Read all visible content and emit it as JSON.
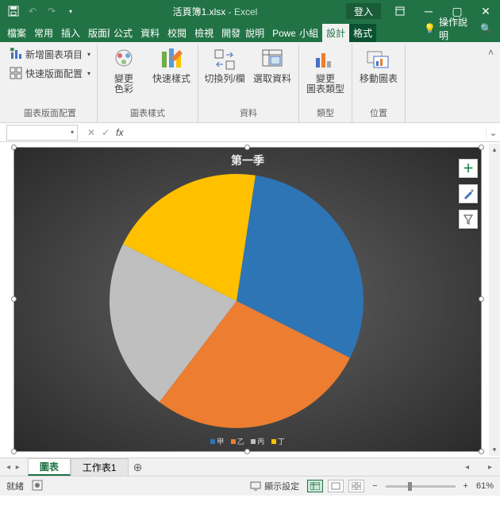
{
  "titlebar": {
    "filename": "活頁簿1.xlsx",
    "app": "Excel",
    "login": "登入"
  },
  "tabs": {
    "items": [
      "檔案",
      "常用",
      "插入",
      "版面配置",
      "公式",
      "資料",
      "校閱",
      "檢視",
      "開發人員",
      "說明",
      "Power",
      "小組",
      "設計",
      "格式"
    ],
    "active": "設計",
    "alt_tabs": [
      "設計",
      "格式"
    ],
    "help_hint": "操作說明"
  },
  "ribbon": {
    "layout": {
      "add_element": "新增圖表項目",
      "quick_layout": "快速版面配置",
      "label": "圖表版面配置"
    },
    "styles": {
      "change_colors": "變更\n色彩",
      "quick_style": "快速樣式",
      "label": "圖表樣式"
    },
    "data": {
      "switch": "切換列/欄",
      "select": "選取資料",
      "label": "資料"
    },
    "type": {
      "change_type": "變更\n圖表類型",
      "label": "類型"
    },
    "location": {
      "move_chart": "移動圖表",
      "label": "位置"
    }
  },
  "formula_bar": {
    "name": "",
    "fx": "fx",
    "value": ""
  },
  "chart_data": {
    "type": "pie",
    "title": "第一季",
    "series": [
      {
        "name": "甲",
        "value": 30,
        "color": "#2e75b6"
      },
      {
        "name": "乙",
        "value": 28,
        "color": "#ed7d31"
      },
      {
        "name": "丙",
        "value": 22,
        "color": "#bfbfbf"
      },
      {
        "name": "丁",
        "value": 20,
        "color": "#ffc000"
      }
    ]
  },
  "sheet_tabs": {
    "tabs": [
      {
        "name": "圖表",
        "active": true
      },
      {
        "name": "工作表1",
        "active": false
      }
    ]
  },
  "statusbar": {
    "ready": "就緒",
    "macro": "",
    "display": "顯示設定",
    "zoom": "61%",
    "zoom_val": 61
  }
}
